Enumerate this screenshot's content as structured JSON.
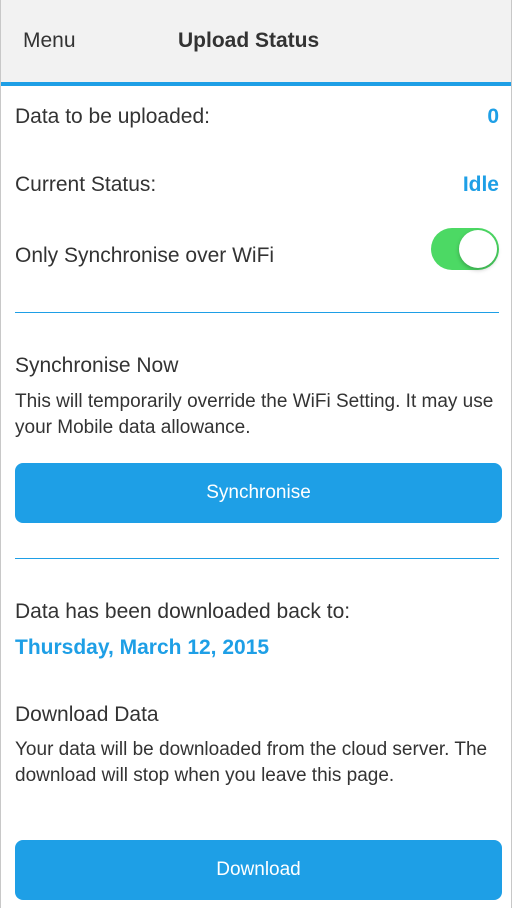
{
  "navbar": {
    "menu_label": "Menu",
    "title": "Upload Status"
  },
  "status": {
    "data_to_upload_label": "Data to be uploaded:",
    "data_to_upload_value": "0",
    "current_status_label": "Current Status:",
    "current_status_value": "Idle",
    "wifi_only_label": "Only Synchronise over WiFi",
    "wifi_only_enabled": true
  },
  "sync": {
    "title": "Synchronise Now",
    "description": "This will temporarily override the WiFi Setting.  It may use your Mobile data allowance.",
    "button_label": "Synchronise"
  },
  "download": {
    "downloaded_back_label": "Data has been downloaded back to:",
    "downloaded_back_date": "Thursday, March 12, 2015",
    "title": "Download Data",
    "description": "Your data will be downloaded from the cloud server. The download will stop when you leave this page.",
    "button_label": "Download"
  },
  "colors": {
    "accent": "#1e9fe6",
    "toggle_on": "#4cd964",
    "navbar_bg": "#f2f2f2"
  }
}
